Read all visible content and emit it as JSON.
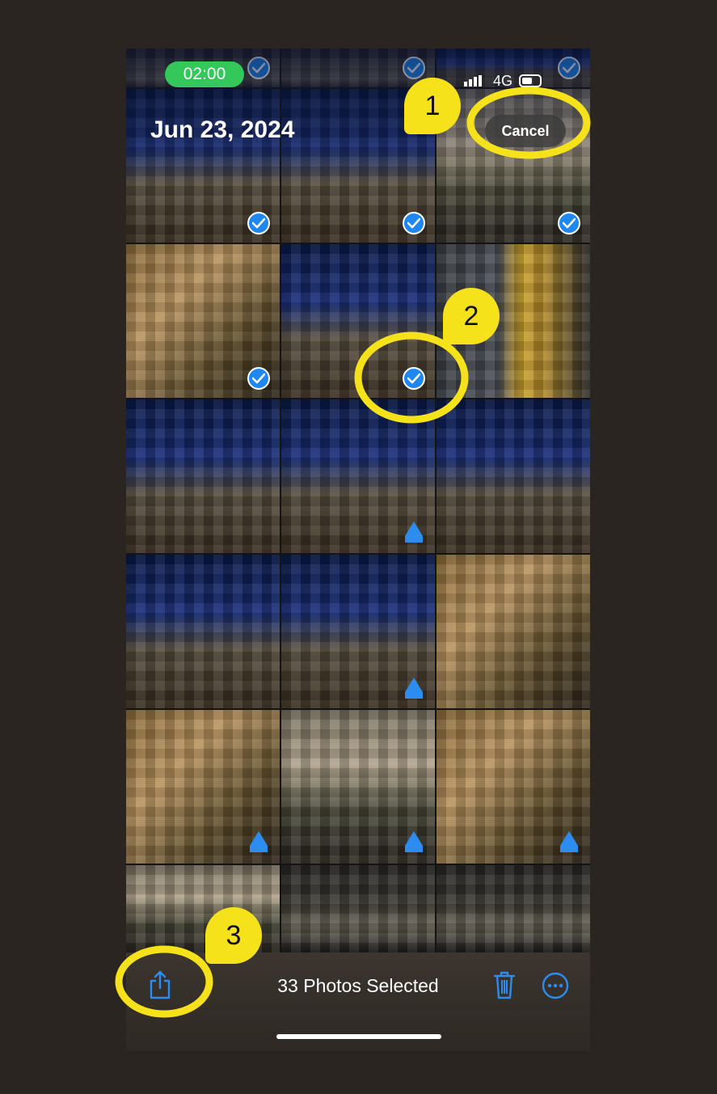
{
  "status_bar": {
    "timer": "02:00",
    "network": "4G"
  },
  "header": {
    "date": "Jun 23, 2024",
    "cancel_label": "Cancel"
  },
  "toolbar": {
    "selected_label": "33 Photos Selected",
    "icons": [
      "share-icon",
      "trash-icon",
      "more-icon"
    ],
    "accent_color": "#2d8cf0"
  },
  "annotations": {
    "marker_1": "1",
    "marker_2": "2",
    "marker_3": "3",
    "highlight_color": "#f6e21a"
  }
}
